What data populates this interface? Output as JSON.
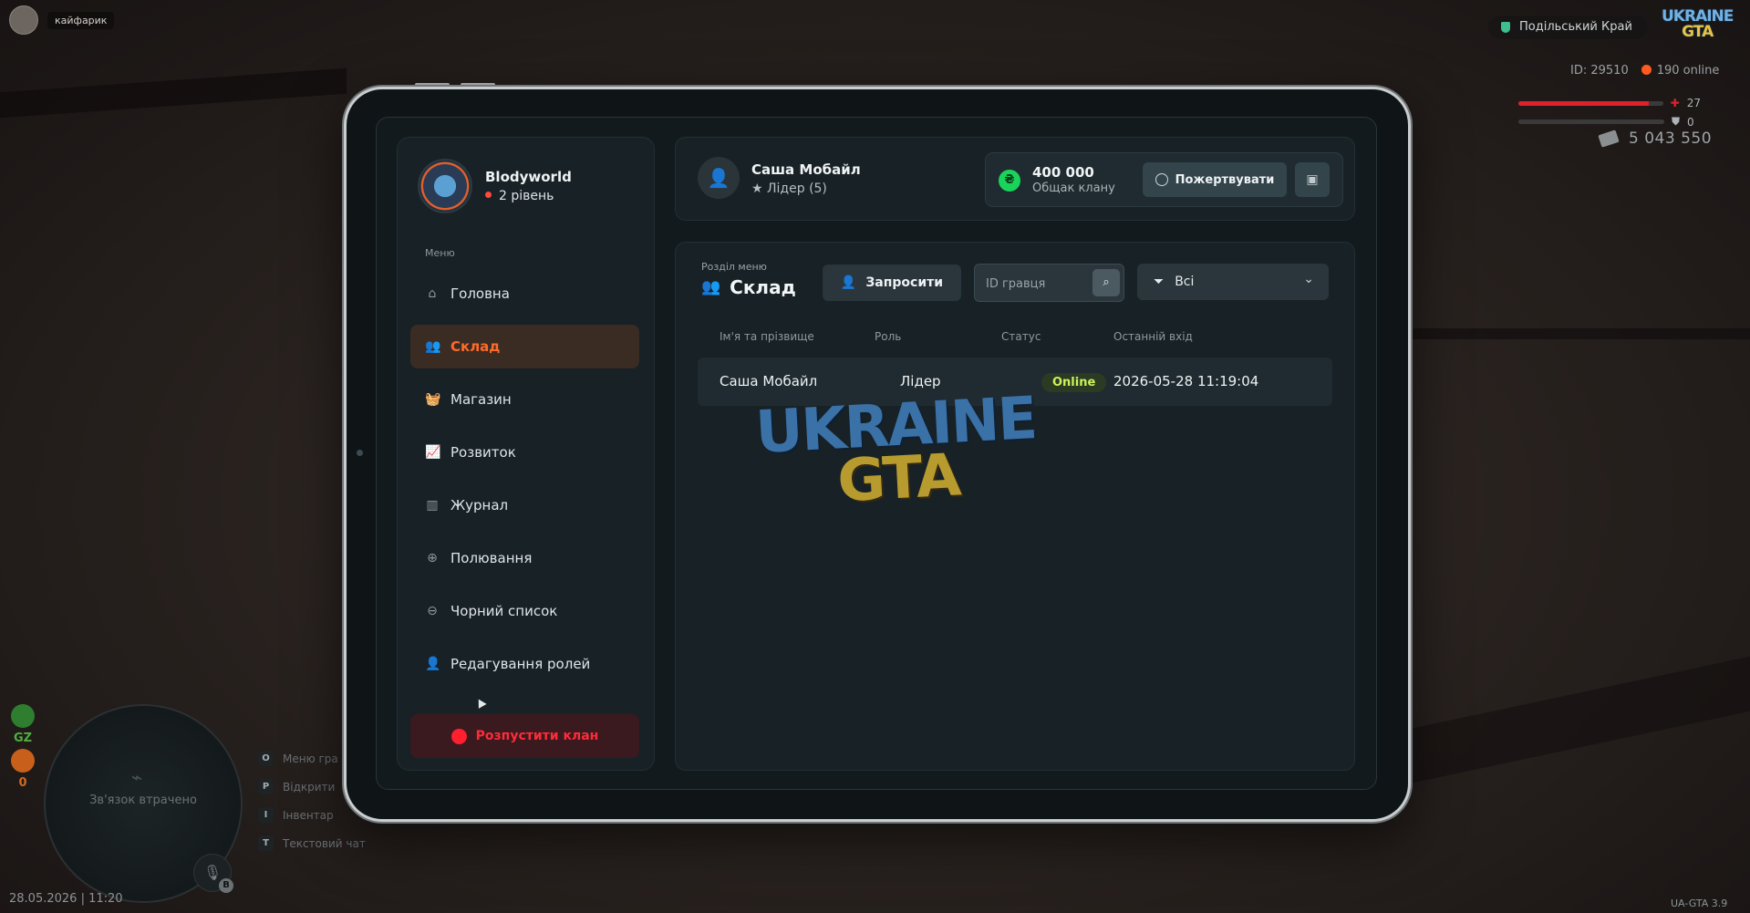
{
  "hud": {
    "nickname": "кайфарик",
    "server": "Подільський Край",
    "logo_line1": "UKRAINE",
    "logo_line2": "GTA",
    "player_id": "ID: 29510",
    "online": "190 online",
    "health": "27",
    "armor": "0",
    "health_fill": 0.9,
    "armor_fill": 0,
    "money": "5 043 550",
    "badge_gz": "GZ",
    "badge_count": "0",
    "minimap_status": "Зв'язок втрачено",
    "keys": [
      {
        "key": "O",
        "label": "Меню гра"
      },
      {
        "key": "P",
        "label": "Відкрити"
      },
      {
        "key": "I",
        "label": "Інвентар"
      },
      {
        "key": "T",
        "label": "Текстовий чат"
      }
    ],
    "datetime": "28.05.2026 | 11:20",
    "version": "UA-GTA 3.9"
  },
  "sidebar": {
    "clan_name": "Blodyworld",
    "clan_level": "2 рівень",
    "menu_title": "Меню",
    "items": [
      {
        "label": "Головна",
        "icon": "home-icon",
        "glyph": "⌂",
        "active": false
      },
      {
        "label": "Склад",
        "icon": "team-icon",
        "glyph": "👥",
        "active": true
      },
      {
        "label": "Магазин",
        "icon": "shop-basket-icon",
        "glyph": "🧺",
        "active": false
      },
      {
        "label": "Розвиток",
        "icon": "chart-line-icon",
        "glyph": "📈",
        "active": false
      },
      {
        "label": "Журнал",
        "icon": "book-icon",
        "glyph": "▥",
        "active": false
      },
      {
        "label": "Полювання",
        "icon": "crosshair-icon",
        "glyph": "⊕",
        "active": false
      },
      {
        "label": "Чорний список",
        "icon": "ban-icon",
        "glyph": "⊖",
        "active": false
      },
      {
        "label": "Редагування ролей",
        "icon": "user-edit-icon",
        "glyph": "👤",
        "active": false
      }
    ],
    "disband_label": "Розпустити клан"
  },
  "topcard": {
    "user_name": "Саша Мобайл",
    "user_role": "Лідер (5)",
    "treasury_amount": "400 000",
    "treasury_label": "Общак клану",
    "donate_label": "Пожертвувати"
  },
  "main": {
    "section_sub": "Розділ меню",
    "section_title": "Склад",
    "invite_label": "Запросити",
    "search_placeholder": "ID гравця",
    "filter_value": "Всі",
    "columns": [
      "Ім'я та прізвище",
      "Роль",
      "Статус",
      "Останній вхід"
    ],
    "rows": [
      {
        "name": "Саша Мобайл",
        "role": "Лідер",
        "status": "Online",
        "last_login": "2026-05-28 11:19:04"
      }
    ],
    "watermark_line1": "UKRAINE",
    "watermark_line2": "GTA"
  },
  "colors": {
    "accent": "#ff5a1f",
    "online": "#c9f25a",
    "danger": "#ff2b3a",
    "coin": "#19d35a"
  }
}
